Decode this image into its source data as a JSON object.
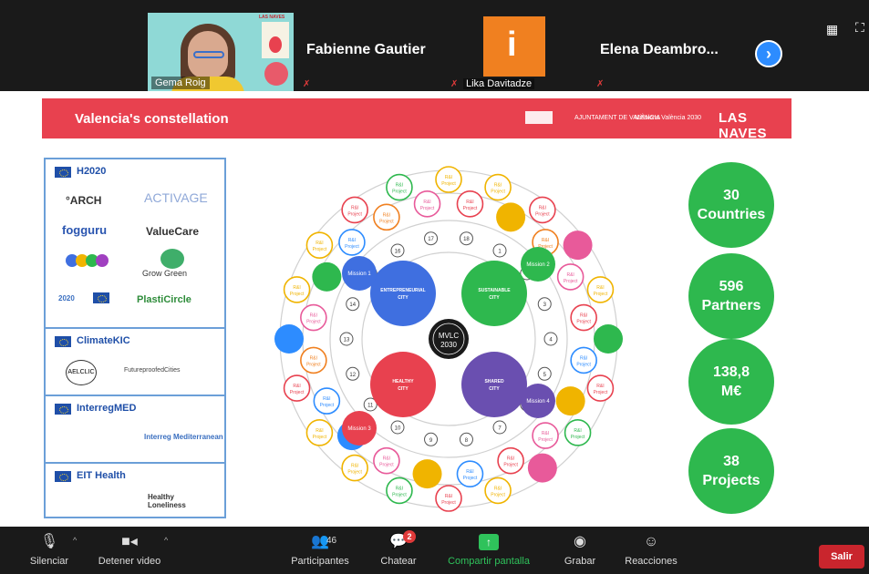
{
  "participants": {
    "video": {
      "name": "Gema Roig",
      "poster_text": "LAS NAVES"
    },
    "tiles": [
      {
        "name": "Fabienne Gautier"
      },
      {
        "name": "Lika Davitadze",
        "avatar_letter": "i"
      },
      {
        "name": "Elena  Deambro..."
      }
    ],
    "next_icon": "›"
  },
  "slide": {
    "banner": {
      "title": "Valencia's constellation",
      "logo_ajuntament": "AJUNTAMENT DE VALÈNCIA",
      "logo_missions": "Missions València 2030",
      "brand": "LAS NAVES"
    },
    "left_panel": {
      "sections": [
        {
          "program": "H2020",
          "partners": [
            "°ARCH",
            "ACTIVAGE",
            "fogguru",
            "ValueCare",
            "Grow Green",
            "2020",
            "PlastiCircle"
          ]
        },
        {
          "program": "ClimateKIC",
          "partners": [
            "AELCLIC",
            "FutureproofedCities"
          ]
        },
        {
          "program": "InterregMED",
          "partners": [
            "Interreg Mediterranean"
          ]
        },
        {
          "program": "EIT Health",
          "partners": [
            "Healthy Loneliness"
          ]
        }
      ]
    },
    "diagram": {
      "center": [
        "MVLC",
        "2030"
      ],
      "cities": [
        {
          "label": "ENTREPRENEURIAL CITY",
          "color": "#3f6fe0"
        },
        {
          "label": "SUSTAINABLE CITY",
          "color": "#2eb84e"
        },
        {
          "label": "HEALTHY CITY",
          "color": "#e8414f"
        },
        {
          "label": "SHARED CITY",
          "color": "#6a4fb0"
        }
      ],
      "missions": [
        "Mission 1",
        "Mission 2",
        "Mission 3",
        "Mission 4"
      ],
      "project_label": [
        "R&I",
        "Project"
      ],
      "numbers": [
        "1",
        "2",
        "3",
        "4",
        "5",
        "6",
        "7",
        "8",
        "9",
        "10",
        "11",
        "12",
        "13",
        "14",
        "15",
        "16",
        "17",
        "18"
      ]
    },
    "stats": [
      {
        "value": "30",
        "label": "Countries"
      },
      {
        "value": "596",
        "label": "Partners"
      },
      {
        "value": "138,8",
        "label": "M€"
      },
      {
        "value": "38",
        "label": "Projects"
      }
    ]
  },
  "toolbar": {
    "mute": "Silenciar",
    "video": "Detener video",
    "participants": "Participantes",
    "participant_count": "46",
    "chat": "Chatear",
    "chat_badge": "2",
    "share": "Compartir pantalla",
    "record": "Grabar",
    "reactions": "Reacciones",
    "leave": "Salir"
  },
  "colors": {
    "banner": "#e8414f",
    "stat_green": "#2eb84e",
    "share_green": "#2fc25b",
    "leave_red": "#c9252d",
    "zoom_blue": "#2d8cff"
  }
}
